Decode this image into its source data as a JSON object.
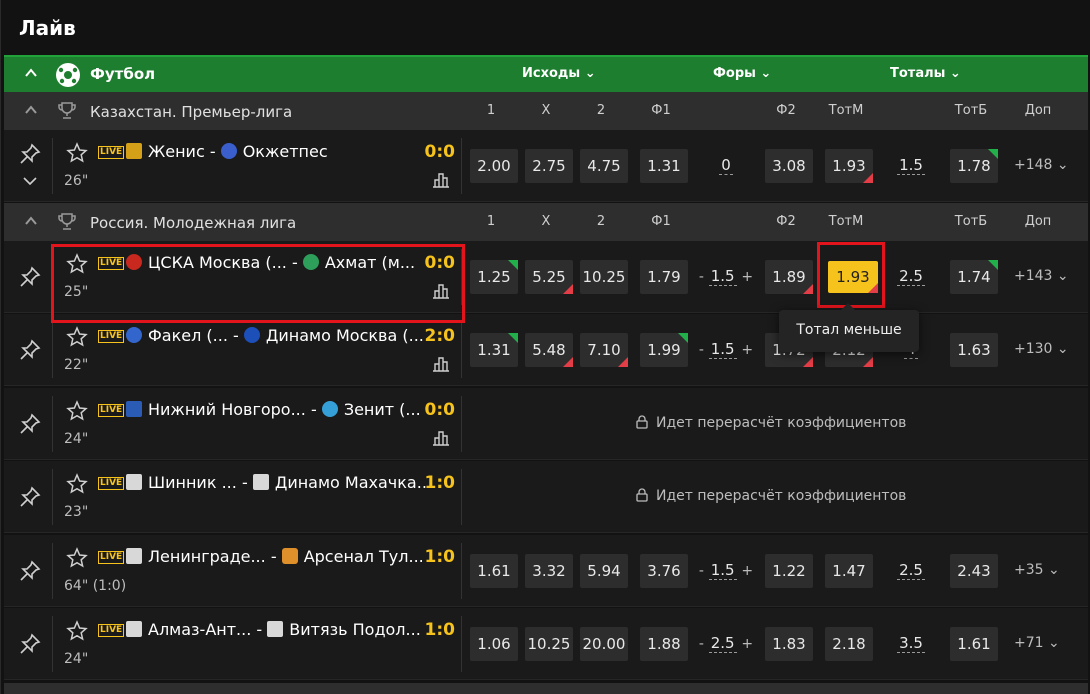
{
  "title": "Лайв",
  "sport": {
    "name": "Футбол",
    "groups": [
      "Исходы",
      "Форы",
      "Тоталы"
    ]
  },
  "columns": [
    "1",
    "X",
    "2",
    "Ф1",
    "Ф2",
    "ТотМ",
    "ТотБ",
    "Доп"
  ],
  "leagues": [
    {
      "name": "Казахстан. Премьер-лига"
    },
    {
      "name": "Россия. Молодежная лига"
    }
  ],
  "matches": [
    {
      "home": "Женис",
      "away": "Окжетпес",
      "score": "0:0",
      "time": "26\"",
      "odds": [
        "2.00",
        "2.75",
        "4.75",
        "1.31",
        "0",
        "3.08",
        "1.93",
        "1.5",
        "1.78"
      ],
      "more": "+148"
    },
    {
      "home": "ЦСКА Москва (...",
      "away": "Ахмат (м...",
      "score": "0:0",
      "time": "25\"",
      "odds": [
        "1.25",
        "5.25",
        "10.25",
        "1.79",
        "1.5",
        "1.89",
        "1.93",
        "2.5",
        "1.74"
      ],
      "more": "+143"
    },
    {
      "home": "Факел (...",
      "away": "Динамо Москва (...",
      "score": "2:0",
      "time": "22\"",
      "odds": [
        "1.31",
        "5.48",
        "7.10",
        "1.99",
        "1.5",
        "1.72",
        "2.12",
        "4",
        "1.63"
      ],
      "more": "+130"
    },
    {
      "home": "Нижний Новгоро...",
      "away": "Зенит (...",
      "score": "0:0",
      "time": "24\"",
      "locked": "Идет перерасчёт коэффициентов"
    },
    {
      "home": "Шинник ...",
      "away": "Динамо Махачка...",
      "score": "1:0",
      "time": "23\"",
      "locked": "Идет перерасчёт коэффициентов"
    },
    {
      "home": "Ленинграде...",
      "away": "Арсенал Тул...",
      "score": "1:0",
      "time": "64\" (1:0)",
      "odds": [
        "1.61",
        "3.32",
        "5.94",
        "3.76",
        "1.5",
        "1.22",
        "1.47",
        "2.5",
        "2.43"
      ],
      "more": "+35"
    },
    {
      "home": "Алмаз-Ант...",
      "away": "Витязь Подол...",
      "score": "1:0",
      "time": "24\"",
      "odds": [
        "1.06",
        "10.25",
        "20.00",
        "1.88",
        "2.5",
        "1.83",
        "2.18",
        "3.5",
        "1.61"
      ],
      "more": "+71"
    }
  ],
  "live_label": "LIVE",
  "separator": "-",
  "plus": "+",
  "minus": "-",
  "tooltip": "Тотал меньше",
  "colors": {
    "accent": "#1e7e2f",
    "highlight": "#f6c21c",
    "up": "#22b04b",
    "down": "#e33e48",
    "marker": "#e3141c"
  }
}
